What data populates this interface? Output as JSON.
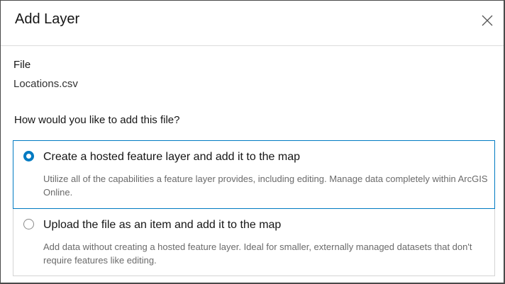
{
  "dialog": {
    "title": "Add Layer",
    "close_icon": "close-icon"
  },
  "file": {
    "label": "File",
    "name": "Locations.csv"
  },
  "question": "How would you like to add this file?",
  "options": [
    {
      "title": "Create a hosted feature layer and add it to the map",
      "description": "Utilize all of the capabilities a feature layer provides, including editing. Manage data completely within ArcGIS Online.",
      "selected": true
    },
    {
      "title": "Upload the file as an item and add it to the map",
      "description": "Add data without creating a hosted feature layer. Ideal for smaller, externally managed datasets that don't require features like editing.",
      "selected": false
    }
  ],
  "colors": {
    "accent": "#007ac2"
  }
}
